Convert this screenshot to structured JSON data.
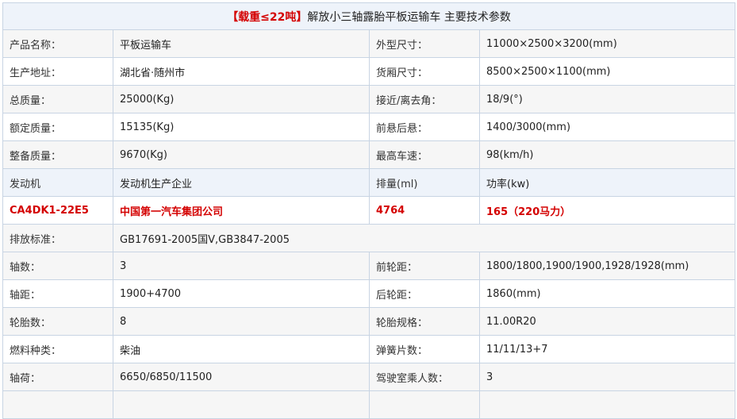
{
  "title": {
    "highlight": "【载重≤22吨】",
    "text": "解放小三轴露胎平板运输车 主要技术参数"
  },
  "rows": [
    {
      "style": "alt",
      "cells": [
        "产品名称：",
        "平板运输车",
        "外型尺寸：",
        "11000×2500×3200(mm)"
      ]
    },
    {
      "style": "plain",
      "cells": [
        "生产地址：",
        "湖北省·随州市",
        "货厢尺寸：",
        "8500×2500×1100(mm)"
      ]
    },
    {
      "style": "alt",
      "cells": [
        "总质量：",
        "25000(Kg)",
        "接近/离去角：",
        "18/9(°)"
      ]
    },
    {
      "style": "plain",
      "cells": [
        "额定质量：",
        "15135(Kg)",
        "前悬后悬：",
        "1400/3000(mm)"
      ]
    },
    {
      "style": "alt",
      "cells": [
        "整备质量：",
        "9670(Kg)",
        "最高车速：",
        "98(km/h)"
      ]
    },
    {
      "style": "blue",
      "cells": [
        "发动机",
        "发动机生产企业",
        "排量(ml)",
        "功率(kw)"
      ]
    },
    {
      "style": "red",
      "cells": [
        "CA4DK1-22E5",
        "中国第一汽车集团公司",
        "4764",
        "165（220马力）"
      ]
    },
    {
      "style": "alt",
      "span": true,
      "cells": [
        "排放标准：",
        "GB17691-2005国Ⅴ,GB3847-2005"
      ]
    },
    {
      "style": "alt",
      "cells": [
        "轴数：",
        "3",
        "前轮距：",
        "1800/1800,1900/1900,1928/1928(mm)"
      ]
    },
    {
      "style": "plain",
      "cells": [
        "轴距：",
        "1900+4700",
        "后轮距：",
        "1860(mm)"
      ]
    },
    {
      "style": "alt",
      "cells": [
        "轮胎数：",
        "8",
        "轮胎规格：",
        "11.00R20"
      ]
    },
    {
      "style": "plain",
      "cells": [
        "燃料种类：",
        "柴油",
        "弹簧片数：",
        "11/11/13+7"
      ]
    },
    {
      "style": "alt",
      "cells": [
        "轴荷：",
        "6650/6850/11500",
        "驾驶室乘人数：",
        "3"
      ]
    }
  ]
}
